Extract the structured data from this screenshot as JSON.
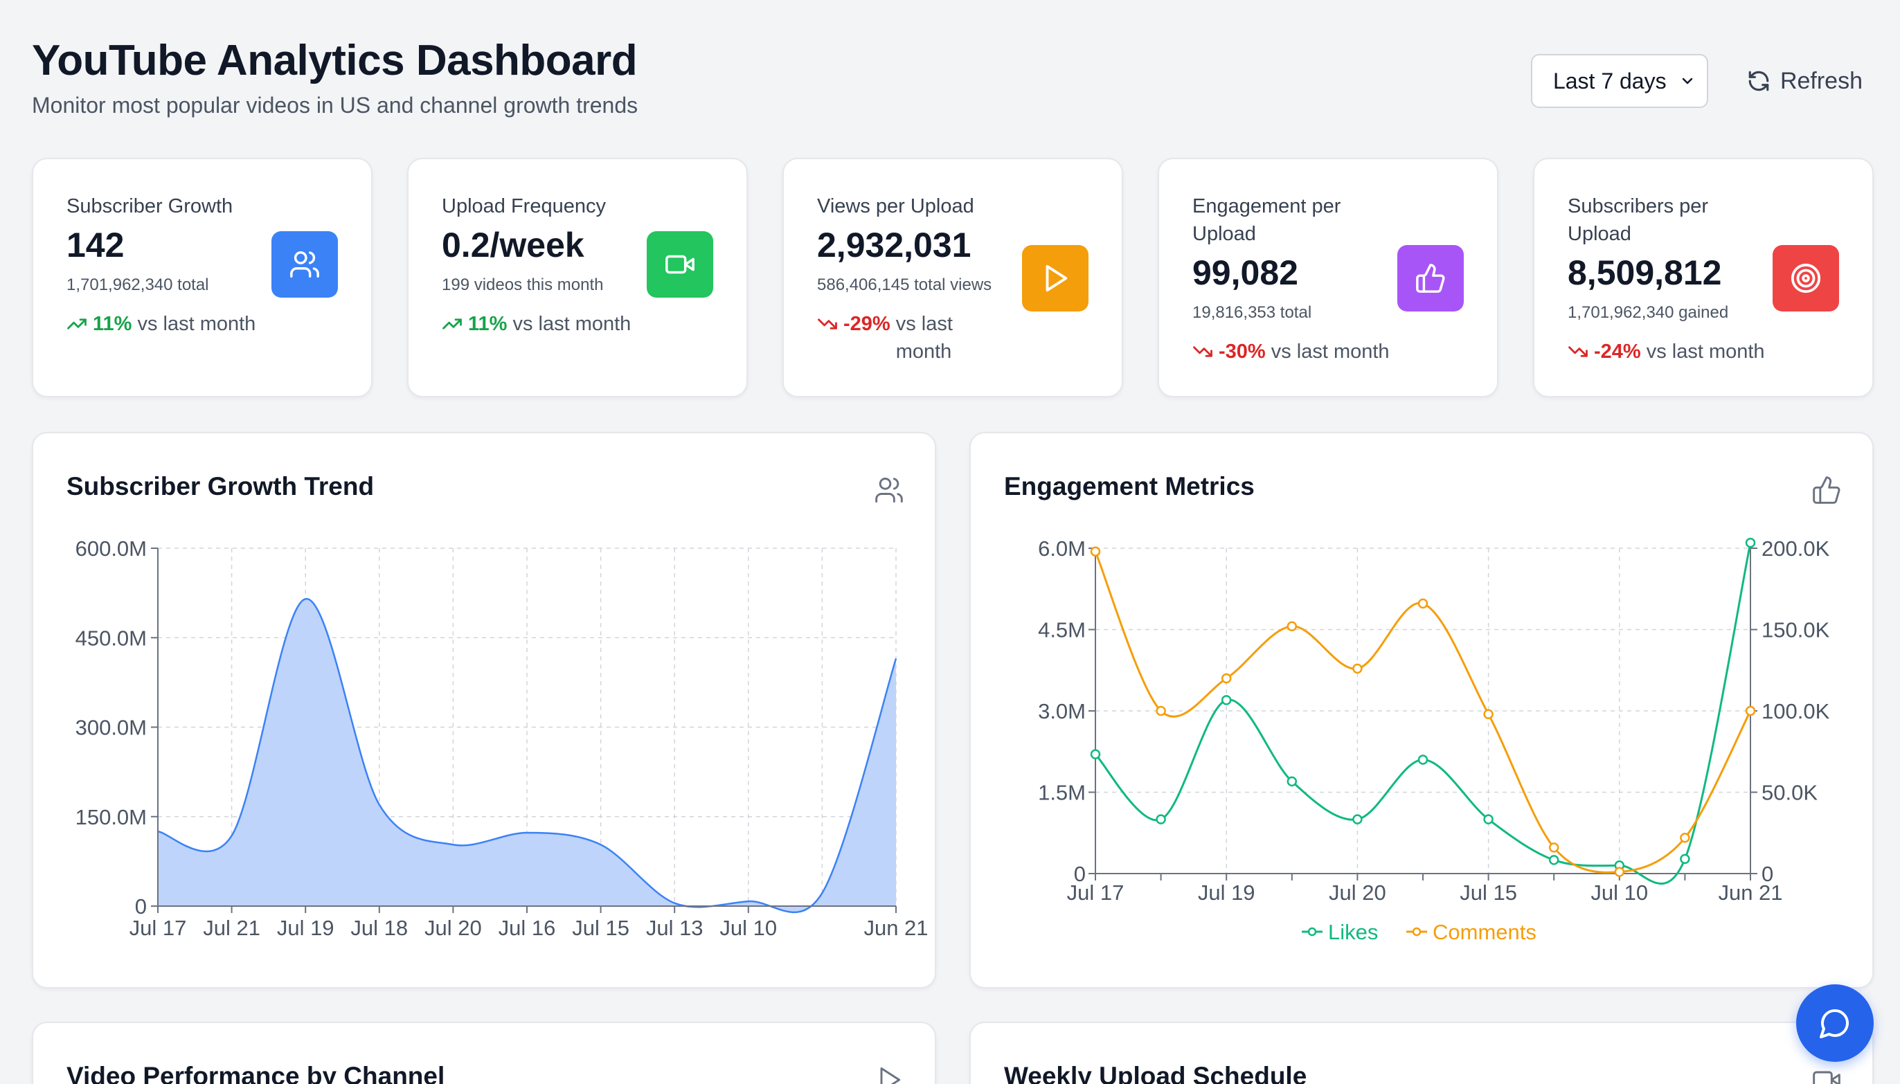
{
  "header": {
    "title": "YouTube Analytics Dashboard",
    "subtitle": "Monitor most popular videos in US and channel growth trends",
    "range_select": "Last 7 days",
    "refresh_label": "Refresh"
  },
  "stats": [
    {
      "label": "Subscriber Growth",
      "value": "142",
      "sub": "1,701,962,340 total",
      "trend": "11%",
      "trend_dir": "up",
      "trend_text": "vs last month",
      "icon": "users-icon",
      "color": "#3b82f6"
    },
    {
      "label": "Upload Frequency",
      "value": "0.2/week",
      "sub": "199 videos this month",
      "trend": "11%",
      "trend_dir": "up",
      "trend_text": "vs last month",
      "icon": "video-icon",
      "color": "#22c55e"
    },
    {
      "label": "Views per Upload",
      "value": "2,932,031",
      "sub": "586,406,145 total views",
      "trend": "-29%",
      "trend_dir": "down",
      "trend_text": "vs last month",
      "icon": "play-icon",
      "color": "#f59e0b"
    },
    {
      "label": "Engagement per Upload",
      "value": "99,082",
      "sub": "19,816,353 total",
      "trend": "-30%",
      "trend_dir": "down",
      "trend_text": "vs last month",
      "icon": "thumbs-up-icon",
      "color": "#a855f7"
    },
    {
      "label": "Subscribers per Upload",
      "value": "8,509,812",
      "sub": "1,701,962,340 gained",
      "trend": "-24%",
      "trend_dir": "down",
      "trend_text": "vs last month",
      "icon": "target-icon",
      "color": "#ef4444"
    }
  ],
  "panels": {
    "subscriber_trend": {
      "title": "Subscriber Growth Trend",
      "icon": "users-icon"
    },
    "engagement": {
      "title": "Engagement Metrics",
      "icon": "thumbs-up-icon"
    },
    "video_performance": {
      "title": "Video Performance by Channel",
      "icon": "play-icon"
    },
    "upload_schedule": {
      "title": "Weekly Upload Schedule",
      "icon": "video-icon"
    }
  },
  "chat_button": {
    "icon": "chat-bubble-icon"
  },
  "chart_data": [
    {
      "type": "area",
      "title": "Subscriber Growth Trend",
      "categories": [
        "Jul 17",
        "Jul 21",
        "Jul 19",
        "Jul 18",
        "Jul 20",
        "Jul 16",
        "Jul 15",
        "Jul 13",
        "Jul 10",
        "Jun 21"
      ],
      "x_tick_labels": [
        "Jul 17",
        "Jul 21",
        "Jul 19",
        "Jul 18",
        "Jul 20",
        "Jul 16",
        "Jul 15",
        "Jul 13",
        "Jul 10",
        "Jun 21"
      ],
      "values": [
        125000000,
        118000000,
        515000000,
        170000000,
        103000000,
        123000000,
        103000000,
        5000000,
        8000000,
        22000000,
        415000000
      ],
      "x_positions": [
        0,
        1,
        2,
        3,
        4,
        5,
        6,
        7,
        8,
        9,
        10
      ],
      "x_label_positions": [
        0,
        1,
        2,
        3,
        4,
        5,
        6,
        7,
        8,
        10
      ],
      "y_ticks": [
        "0",
        "150.0M",
        "300.0M",
        "450.0M",
        "600.0M"
      ],
      "ylim": [
        0,
        600000000
      ],
      "grid": true,
      "color": "#3b82f6"
    },
    {
      "type": "line",
      "title": "Engagement Metrics",
      "categories": [
        "Jul 17",
        "",
        "Jul 19",
        "",
        "Jul 20",
        "",
        "Jul 15",
        "",
        "Jul 10",
        "",
        "Jun 21"
      ],
      "series": [
        {
          "name": "Likes",
          "axis": "left",
          "color": "#10b981",
          "values": [
            2200000,
            1000000,
            3200000,
            1700000,
            1000000,
            2100000,
            1000000,
            250000,
            150000,
            270000,
            6100000
          ]
        },
        {
          "name": "Comments",
          "axis": "right",
          "color": "#f59e0b",
          "values": [
            198000,
            100000,
            120000,
            152000,
            126000,
            166000,
            98000,
            16000,
            1000,
            22000,
            100000
          ]
        }
      ],
      "y_left_ticks": [
        "0",
        "1.5M",
        "3.0M",
        "4.5M",
        "6.0M"
      ],
      "y_left_lim": [
        0,
        6000000
      ],
      "y_right_ticks": [
        "0",
        "50.0K",
        "100.0K",
        "150.0K",
        "200.0K"
      ],
      "y_right_lim": [
        0,
        200000
      ],
      "legend": "bottom",
      "grid": true
    }
  ]
}
